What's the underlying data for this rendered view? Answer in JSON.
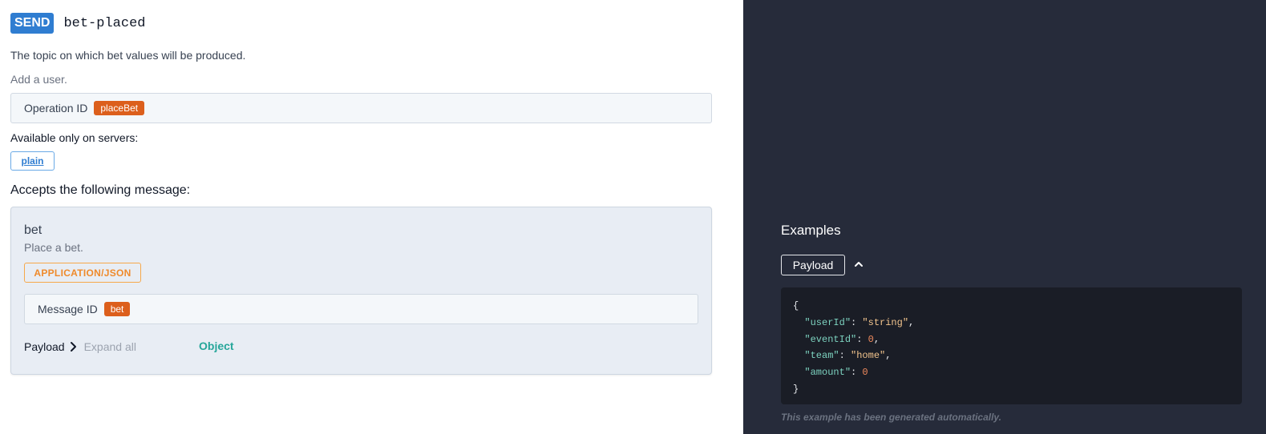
{
  "operation": {
    "action_badge": "SEND",
    "channel": "bet-placed",
    "description": "The topic on which bet values will be produced.",
    "summary": "Add a user.",
    "operation_id_label": "Operation ID",
    "operation_id_value": "placeBet",
    "servers_label": "Available only on servers:",
    "servers": [
      "plain"
    ],
    "accepts_label": "Accepts the following message:"
  },
  "message": {
    "name": "bet",
    "summary": "Place a bet.",
    "content_type": "APPLICATION/JSON",
    "message_id_label": "Message ID",
    "message_id_value": "bet",
    "payload_label": "Payload",
    "expand_all_label": "Expand all",
    "payload_type": "Object"
  },
  "examples": {
    "title": "Examples",
    "tab_label": "Payload",
    "open_brace": "{",
    "close_brace": "}",
    "fields": [
      {
        "key": "\"userId\"",
        "value": "\"string\"",
        "kind": "string",
        "comma": ","
      },
      {
        "key": "\"eventId\"",
        "value": "0",
        "kind": "number",
        "comma": ","
      },
      {
        "key": "\"team\"",
        "value": "\"home\"",
        "kind": "string",
        "comma": ","
      },
      {
        "key": "\"amount\"",
        "value": "0",
        "kind": "number",
        "comma": ""
      }
    ],
    "note": "This example has been generated automatically."
  },
  "icons": {
    "payload_expand": "chevron-right-icon",
    "examples_collapse": "chevron-up-icon"
  },
  "colors": {
    "send_badge": "#2f7dd1",
    "id_tag": "#dc5f1c",
    "content_type": "#ef8a2b",
    "object_type": "#26a69a",
    "right_panel": "#262b3a",
    "code_bg": "#1a1d26"
  }
}
